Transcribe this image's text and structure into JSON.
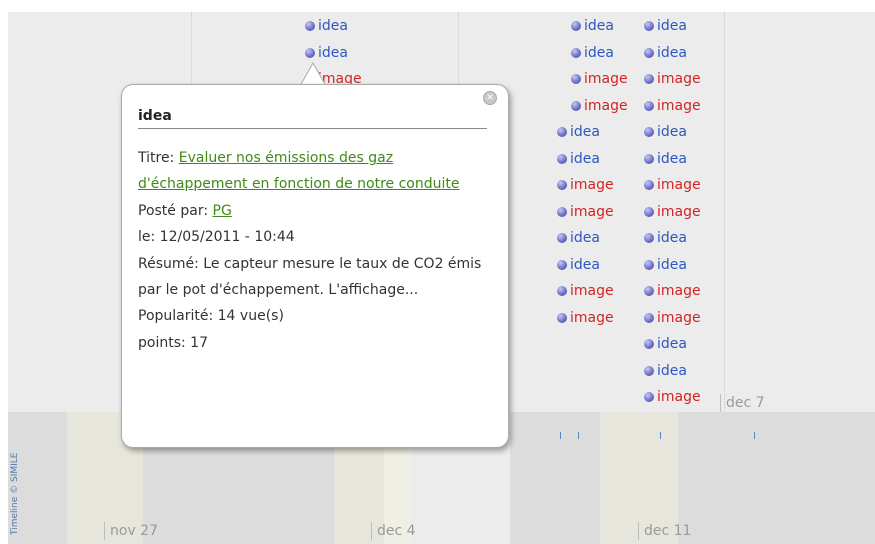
{
  "timeline": {
    "credit": "Timeline © SIMILE",
    "date_labels": [
      "nov 27",
      "dec 4",
      "dec 11",
      "dec 7"
    ]
  },
  "events": {
    "c1": [
      "idea",
      "idea",
      "image"
    ],
    "c2": [
      "idea",
      "idea",
      "image",
      "image"
    ],
    "c3": [
      "idea",
      "idea",
      "image",
      "image",
      "idea",
      "idea",
      "image",
      "image"
    ],
    "c4": [
      "idea",
      "idea",
      "image",
      "image",
      "idea",
      "idea",
      "image",
      "image",
      "idea",
      "idea",
      "image",
      "image",
      "idea",
      "idea",
      "image"
    ]
  },
  "popup": {
    "title": "idea",
    "title_label": "Titre:",
    "title_link": "Evaluer nos émissions des gaz d'échappement en fonction de notre conduite",
    "author_label": "Posté par:",
    "author_link": "PG",
    "date_line": "le: 12/05/2011 - 10:44",
    "summary": "Résumé: Le capteur mesure le taux de CO2 émis par le pot d'échappement. L'affichage...",
    "popularity": "Popularité: 14 vue(s)",
    "points": "points: 17",
    "close_icon": "close-icon"
  },
  "colors": {
    "idea": "#2e56c4",
    "image": "#d12525",
    "link": "#3e8b16"
  }
}
